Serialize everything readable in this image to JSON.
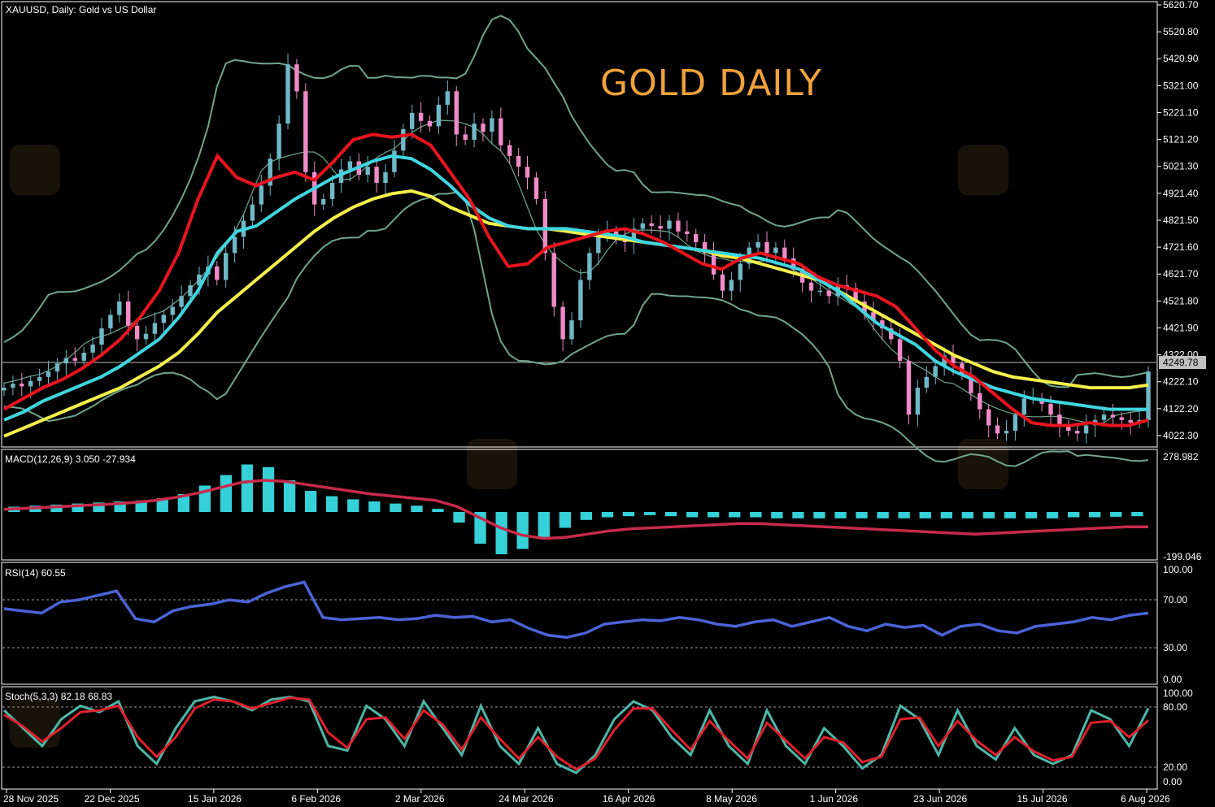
{
  "header": {
    "symbol_line": "XAUUSD, Daily:  Gold vs US Dollar",
    "big_title": "GOLD DAILY"
  },
  "colors": {
    "background": "#000000",
    "bull_candle": "#6fb8c8",
    "bear_candle": "#f08ac8",
    "ema_fast": "#e8141e",
    "ema_mid": "#3fd6e0",
    "ema_slow": "#f4f04a",
    "bollinger": "#6fa58a",
    "macd_hist": "#35d0d8",
    "macd_signal": "#c72a4a",
    "rsi_line": "#4b63d6",
    "stoch_main": "#4cb8a8",
    "stoch_signal": "#e0202c",
    "title_text": "#f2a23a"
  },
  "panels": {
    "macd": {
      "label": "MACD(12,26,9) 3.050 -27.934",
      "top_value": "278.982",
      "bottom_value": "-199.046"
    },
    "rsi": {
      "label": "RSI(14) 60.55",
      "ticks": [
        "100.00",
        "70.00",
        "30.00",
        "0.00"
      ]
    },
    "stoch": {
      "label": "Stoch(5,3,3) 82.18 68.83",
      "ticks": [
        "100.00",
        "80.00",
        "20.00",
        "0.00"
      ]
    }
  },
  "price_axis": {
    "ticks": [
      "5620.70",
      "5520.80",
      "5420.90",
      "5321.00",
      "5221.10",
      "5121.20",
      "5021.30",
      "4921.40",
      "4821.50",
      "4721.60",
      "4621.70",
      "4521.80",
      "4421.90",
      "4322.00",
      "4222.10",
      "4122.20",
      "4022.30"
    ],
    "current_price": "4249.78"
  },
  "date_axis": [
    "28 Nov 2025",
    "22 Dec 2025",
    "15 Jan 2026",
    "6 Feb 2026",
    "2 Mar 2026",
    "24 Mar 2026",
    "16 Apr 2026",
    "8 May 2026",
    "1 Jun 2026",
    "23 Jun 2026",
    "15 Jul 2026",
    "6 Aug 2026"
  ],
  "chart_data": {
    "type": "line",
    "series": [
      {
        "name": "XAUUSD close",
        "values": [
          4200,
          4215,
          4205,
          4225,
          4240,
          4260,
          4290,
          4310,
          4300,
          4330,
          4360,
          4420,
          4470,
          4520,
          4430,
          4380,
          4400,
          4440,
          4470,
          4500,
          4540,
          4580,
          4620,
          4650,
          4600,
          4700,
          4760,
          4820,
          4880,
          4950,
          5050,
          5180,
          5400,
          5300,
          5000,
          4880,
          4900,
          4960,
          5010,
          5040,
          4990,
          5020,
          4960,
          5000,
          5080,
          5160,
          5220,
          5190,
          5170,
          5250,
          5300,
          5140,
          5120,
          5180,
          5150,
          5200,
          5100,
          5060,
          5020,
          4980,
          4900,
          4700,
          4500,
          4380,
          4450,
          4600,
          4700,
          4760,
          4780,
          4760,
          4740,
          4790,
          4810,
          4800,
          4790,
          4820,
          4780,
          4770,
          4740,
          4700,
          4620,
          4560,
          4600,
          4660,
          4720,
          4740,
          4700,
          4720,
          4680,
          4640,
          4590,
          4560,
          4560,
          4540,
          4580,
          4570,
          4520,
          4480,
          4450,
          4420,
          4380,
          4300,
          4100,
          4200,
          4240,
          4280,
          4320,
          4290,
          4250,
          4180,
          4120,
          4060,
          4030,
          4040,
          4100,
          4160,
          4160,
          4140,
          4100,
          4060,
          4040,
          4030,
          4060,
          4080,
          4100,
          4090,
          4080,
          4070,
          4080,
          4260
        ]
      },
      {
        "name": "EMA fast",
        "values": [
          4120,
          4160,
          4200,
          4230,
          4270,
          4320,
          4380,
          4460,
          4560,
          4700,
          4900,
          5060,
          4980,
          4950,
          4980,
          5000,
          4970,
          5040,
          5120,
          5140,
          5130,
          5140,
          5100,
          5000,
          4900,
          4760,
          4650,
          4660,
          4720,
          4740,
          4760,
          4780,
          4790,
          4770,
          4740,
          4700,
          4660,
          4640,
          4680,
          4700,
          4680,
          4660,
          4610,
          4580,
          4560,
          4540,
          4500,
          4420,
          4340,
          4280,
          4240,
          4180,
          4120,
          4070,
          4060,
          4060,
          4070,
          4060,
          4060,
          4080
        ]
      },
      {
        "name": "EMA mid",
        "values": [
          4080,
          4110,
          4150,
          4180,
          4210,
          4240,
          4280,
          4330,
          4380,
          4460,
          4560,
          4700,
          4780,
          4800,
          4850,
          4900,
          4940,
          4980,
          5010,
          5040,
          5060,
          5050,
          5010,
          4950,
          4880,
          4830,
          4800,
          4790,
          4790,
          4790,
          4780,
          4770,
          4760,
          4740,
          4730,
          4720,
          4710,
          4700,
          4690,
          4680,
          4660,
          4640,
          4600,
          4560,
          4500,
          4440,
          4400,
          4360,
          4300,
          4260,
          4230,
          4200,
          4180,
          4160,
          4150,
          4140,
          4130,
          4120,
          4120,
          4120
        ]
      },
      {
        "name": "EMA slow",
        "values": [
          4020,
          4050,
          4080,
          4110,
          4140,
          4170,
          4200,
          4240,
          4280,
          4330,
          4400,
          4480,
          4540,
          4600,
          4660,
          4720,
          4780,
          4830,
          4870,
          4900,
          4920,
          4930,
          4910,
          4870,
          4840,
          4810,
          4800,
          4790,
          4790,
          4780,
          4770,
          4760,
          4750,
          4740,
          4730,
          4720,
          4710,
          4690,
          4680,
          4660,
          4640,
          4620,
          4600,
          4560,
          4520,
          4480,
          4440,
          4400,
          4360,
          4320,
          4290,
          4260,
          4240,
          4230,
          4220,
          4210,
          4200,
          4200,
          4200,
          4210
        ]
      },
      {
        "name": "MACD histogram",
        "values": [
          10,
          12,
          14,
          16,
          18,
          20,
          22,
          26,
          34,
          50,
          70,
          90,
          85,
          60,
          40,
          30,
          24,
          20,
          16,
          12,
          6,
          -20,
          -60,
          -80,
          -70,
          -50,
          -30,
          -15,
          -10,
          -8,
          -6,
          -8,
          -10,
          -10,
          -10,
          -10,
          -12,
          -12,
          -12,
          -12,
          -12,
          -12,
          -12,
          -12,
          -12,
          -12,
          -12,
          -12,
          -12,
          -12,
          -10,
          -10,
          -9,
          -8
        ]
      },
      {
        "name": "MACD signal",
        "values": [
          5,
          7,
          9,
          11,
          13,
          15,
          18,
          22,
          28,
          36,
          46,
          56,
          60,
          58,
          52,
          46,
          40,
          34,
          30,
          26,
          22,
          10,
          -10,
          -30,
          -44,
          -50,
          -48,
          -42,
          -36,
          -32,
          -30,
          -28,
          -26,
          -24,
          -22,
          -22,
          -24,
          -26,
          -28,
          -30,
          -32,
          -34,
          -36,
          -38,
          -40,
          -42,
          -40,
          -38,
          -36,
          -34,
          -32,
          -30,
          -28,
          -27.934
        ]
      },
      {
        "name": "RSI",
        "values": [
          64,
          62,
          60,
          70,
          72,
          76,
          80,
          55,
          52,
          62,
          66,
          68,
          72,
          70,
          78,
          84,
          88,
          56,
          54,
          55,
          56,
          54,
          55,
          58,
          56,
          57,
          52,
          54,
          46,
          40,
          38,
          42,
          50,
          52,
          54,
          53,
          56,
          54,
          50,
          48,
          52,
          54,
          48,
          52,
          56,
          48,
          44,
          50,
          47,
          49,
          40,
          48,
          50,
          44,
          42,
          48,
          50,
          52,
          56,
          54,
          58,
          60
        ]
      },
      {
        "name": "Stoch main",
        "values": [
          80,
          60,
          40,
          70,
          85,
          78,
          90,
          40,
          20,
          60,
          90,
          95,
          90,
          80,
          92,
          95,
          90,
          40,
          35,
          85,
          70,
          40,
          90,
          60,
          30,
          85,
          40,
          20,
          60,
          20,
          10,
          30,
          70,
          90,
          80,
          50,
          30,
          80,
          40,
          20,
          80,
          40,
          20,
          60,
          40,
          15,
          30,
          85,
          70,
          30,
          80,
          40,
          25,
          60,
          30,
          20,
          30,
          80,
          70,
          40,
          82.18
        ]
      },
      {
        "name": "Stoch signal",
        "values": [
          75,
          62,
          45,
          60,
          78,
          80,
          85,
          50,
          28,
          50,
          82,
          92,
          90,
          82,
          88,
          94,
          92,
          55,
          38,
          70,
          72,
          48,
          80,
          64,
          36,
          72,
          48,
          26,
          50,
          28,
          14,
          26,
          58,
          82,
          82,
          58,
          36,
          68,
          46,
          26,
          66,
          46,
          26,
          50,
          44,
          22,
          28,
          70,
          72,
          40,
          68,
          46,
          30,
          50,
          34,
          24,
          28,
          66,
          68,
          50,
          68.83
        ]
      }
    ],
    "bollinger_upper_peak": 5530,
    "price_range": [
      3980,
      5620.7
    ]
  }
}
